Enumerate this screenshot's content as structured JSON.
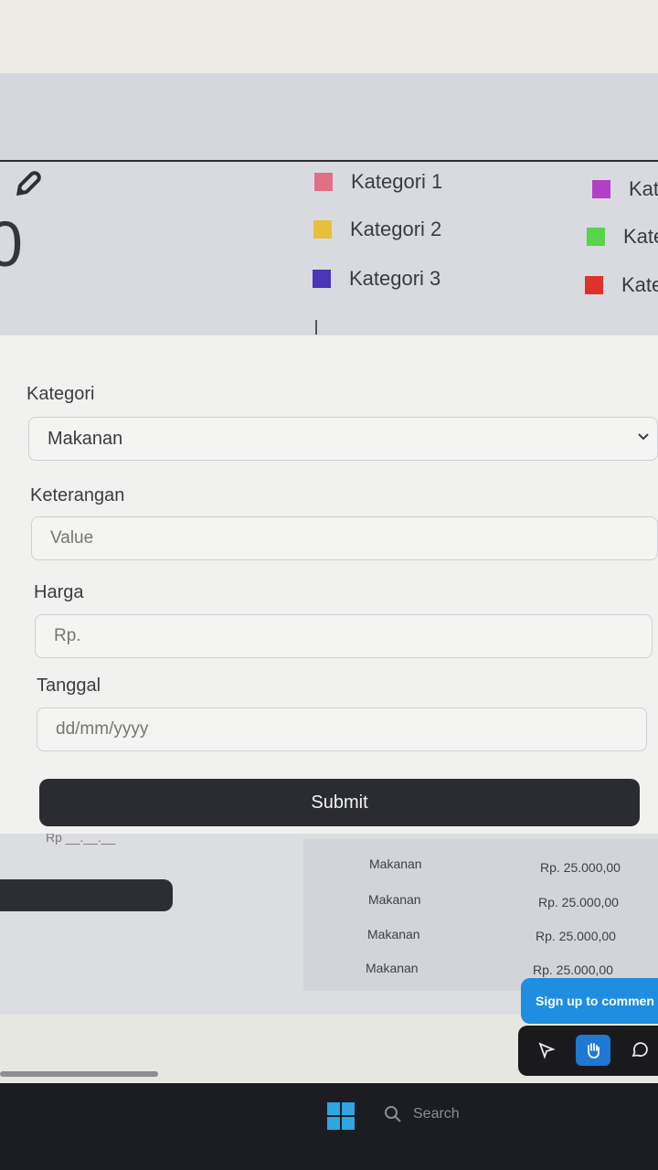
{
  "summary": {
    "total_value": "0",
    "legend": [
      {
        "label": "Kategori 1",
        "color": "#e06f86"
      },
      {
        "label": "Kategori 2",
        "color": "#e6c03a"
      },
      {
        "label": "Kategori 3",
        "color": "#4b35b8"
      },
      {
        "label": "Kat",
        "color": "#b23fc6"
      },
      {
        "label": "Kate",
        "color": "#58d34a"
      },
      {
        "label": "Kate",
        "color": "#e0322a"
      }
    ]
  },
  "form": {
    "kategori_label": "Kategori",
    "kategori_value": "Makanan",
    "keterangan_label": "Keterangan",
    "keterangan_placeholder": "Value",
    "harga_label": "Harga",
    "harga_placeholder": "Rp.",
    "tanggal_label": "Tanggal",
    "tanggal_placeholder": "dd/mm/yyyy",
    "submit_label": "Submit"
  },
  "behind": {
    "partial_text": "Rp __.__.__",
    "table_rows": [
      {
        "kategori": "Makanan",
        "harga": "Rp. 25.000,00"
      },
      {
        "kategori": "Makanan",
        "harga": "Rp. 25.000,00"
      },
      {
        "kategori": "Makanan",
        "harga": "Rp. 25.000,00"
      },
      {
        "kategori": "Makanan",
        "harga": "Rp. 25.000,00"
      }
    ]
  },
  "comment_widget": {
    "label": "Sign up to commen",
    "tools": [
      "pointer-icon",
      "hand-icon",
      "comment-icon"
    ]
  },
  "taskbar": {
    "search_label": "Search"
  }
}
